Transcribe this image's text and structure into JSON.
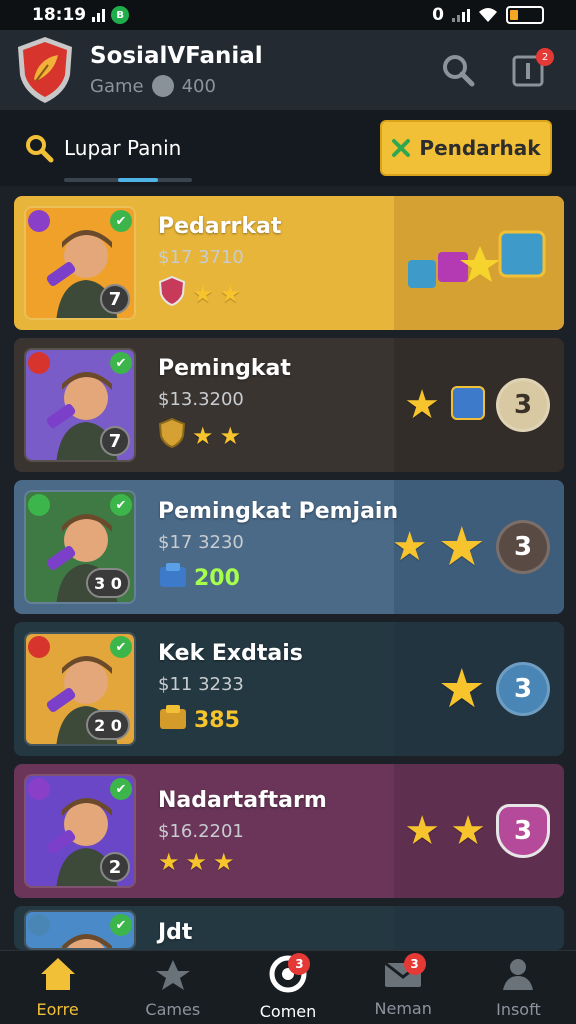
{
  "status": {
    "time": "18:19",
    "app_badge": "B",
    "signal": "0"
  },
  "header": {
    "title": "SosialVFanial",
    "subtitle": "Game",
    "coins": "400",
    "notification_count": "2"
  },
  "search": {
    "label": "Lupar Panin",
    "filter_label": "Pendarhak"
  },
  "cards": [
    {
      "name": "Pedarrkat",
      "price": "$17 3710",
      "level": "7",
      "meta_value": "",
      "rank": "",
      "bg": "#e7b53a",
      "right_bg": "#d4a132",
      "avatar_bg": "#f0a12a"
    },
    {
      "name": "Pemingkat",
      "price": "$13.3200",
      "level": "7",
      "meta_value": "",
      "rank": "3",
      "bg": "#3a3430",
      "right_bg": "#332d29",
      "avatar_bg": "#7a5cc9"
    },
    {
      "name": "Pemingkat Pemjain",
      "price": "$17 3230",
      "level": "3 0",
      "meta_value": "200",
      "rank": "3",
      "bg": "#4a6a88",
      "right_bg": "#3e5d7b",
      "avatar_bg": "#3f7a45"
    },
    {
      "name": "Kek Exdtais",
      "price": "$11 3233",
      "level": "2 0",
      "meta_value": "385",
      "rank": "3",
      "bg": "#243842",
      "right_bg": "#223440",
      "avatar_bg": "#e3a63a"
    },
    {
      "name": "Nadartaftarm",
      "price": "$16.2201",
      "level": "2",
      "meta_value": "",
      "rank": "3",
      "bg": "#6a3558",
      "right_bg": "#5e2f4e",
      "avatar_bg": "#6a47c7"
    },
    {
      "name": "Jdt",
      "price": "",
      "level": "",
      "meta_value": "",
      "rank": "",
      "bg": "#243842",
      "right_bg": "#223440",
      "avatar_bg": "#4a8ac9"
    }
  ],
  "nav": [
    {
      "label": "Eorre",
      "icon": "home-icon",
      "active": true,
      "count": ""
    },
    {
      "label": "Cames",
      "icon": "games-icon",
      "active": false,
      "count": ""
    },
    {
      "label": "Comen",
      "icon": "comment-icon",
      "active": false,
      "count": "3"
    },
    {
      "label": "Neman",
      "icon": "mail-icon",
      "active": false,
      "count": "3"
    },
    {
      "label": "Insoft",
      "icon": "profile-icon",
      "active": false,
      "count": ""
    }
  ]
}
